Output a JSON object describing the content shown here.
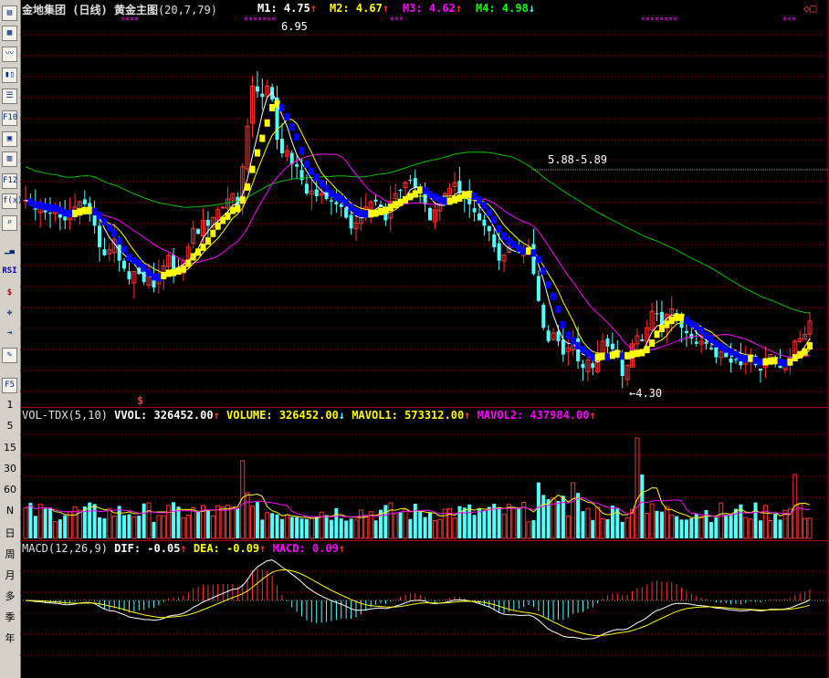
{
  "toolbar": {
    "icons": [
      "menu-icon",
      "grid-icon",
      "line-chart-icon",
      "candle-icon",
      "list-icon",
      "f10-icon",
      "book-icon",
      "doc-icon",
      "f12-icon",
      "fx-icon",
      "search-icon",
      "bar-chart-icon",
      "rsi-icon",
      "dollar-icon",
      "move-icon",
      "export-icon",
      "pen-icon",
      "f5-icon"
    ],
    "labels": {
      "f10": "F10",
      "f12": "F12",
      "fx": "f(x)",
      "rsi": "RSI",
      "f5": "F5"
    },
    "periods": [
      "1",
      "5",
      "15",
      "30",
      "60",
      "N",
      "日",
      "周",
      "月",
      "多",
      "季",
      "年"
    ]
  },
  "main": {
    "stock_name": "金地集团",
    "period_label": "(日线)",
    "indicator_name": "黄金主图",
    "params": "(20,7,79)",
    "m1": {
      "label": "M1:",
      "value": "4.75",
      "color": "#ffffff"
    },
    "m2": {
      "label": "M2:",
      "value": "4.67",
      "color": "#ffff00"
    },
    "m3": {
      "label": "M3:",
      "value": "4.62",
      "color": "#ff00ff"
    },
    "m4": {
      "label": "M4:",
      "value": "4.98",
      "color": "#00ff00"
    },
    "high_label": "6.95",
    "low_label": "←4.30",
    "range_label": "5.88-5.89",
    "marker": "$",
    "corner_icon": "diamond-icon",
    "price_range": [
      4.15,
      7.02
    ]
  },
  "volume": {
    "name": "VOL-TDX(5,10)",
    "vvol": {
      "label": "VVOL:",
      "value": "326452.00"
    },
    "volume": {
      "label": "VOLUME:",
      "value": "326452.00"
    },
    "mavol1": {
      "label": "MAVOL1:",
      "value": "573312.00"
    },
    "mavol2": {
      "label": "MAVOL2:",
      "value": "437984.00"
    }
  },
  "macd": {
    "name": "MACD(12,26,9)",
    "dif": {
      "label": "DIF:",
      "value": "-0.05"
    },
    "dea": {
      "label": "DEA:",
      "value": "-0.09"
    },
    "macd": {
      "label": "MACD:",
      "value": "0.09"
    }
  },
  "colors": {
    "up": "#ff3232",
    "down": "#54ffff",
    "ma_white": "#ffffff",
    "ma_yellow": "#ffff00",
    "ma_magenta": "#ff00ff",
    "ma_green": "#00c000",
    "step_yellow": "#ffff00",
    "step_blue": "#0000ff",
    "grid": "#8b0000"
  },
  "chart_data": {
    "type": "candlestick",
    "closes": [
      5.65,
      5.62,
      5.58,
      5.6,
      5.56,
      5.55,
      5.58,
      5.52,
      5.5,
      5.55,
      5.6,
      5.64,
      5.62,
      5.58,
      5.46,
      5.3,
      5.24,
      5.28,
      5.36,
      5.2,
      5.14,
      5.06,
      5.12,
      5.1,
      5.04,
      5.1,
      5.0,
      5.1,
      5.16,
      5.24,
      5.14,
      5.12,
      5.2,
      5.3,
      5.44,
      5.4,
      5.5,
      5.46,
      5.52,
      5.58,
      5.6,
      5.66,
      5.7,
      5.6,
      5.9,
      6.2,
      6.5,
      6.46,
      6.42,
      6.5,
      6.4,
      6.1,
      6.0,
      6.02,
      5.92,
      5.9,
      5.8,
      5.7,
      5.72,
      5.68,
      5.7,
      5.66,
      5.64,
      5.62,
      5.6,
      5.52,
      5.44,
      5.48,
      5.56,
      5.6,
      5.64,
      5.64,
      5.6,
      5.5,
      5.64,
      5.7,
      5.72,
      5.78,
      5.8,
      5.74,
      5.7,
      5.62,
      5.5,
      5.58,
      5.66,
      5.7,
      5.74,
      5.78,
      5.7,
      5.66,
      5.62,
      5.56,
      5.5,
      5.46,
      5.42,
      5.3,
      5.2,
      5.24,
      5.3,
      5.32,
      5.26,
      5.28,
      5.3,
      5.1,
      4.9,
      4.7,
      4.6,
      4.66,
      4.6,
      4.5,
      4.55,
      4.6,
      4.45,
      4.4,
      4.46,
      4.4,
      4.5,
      4.6,
      4.56,
      4.54,
      4.48,
      4.34,
      4.42,
      4.58,
      4.64,
      4.6,
      4.7,
      4.82,
      4.8,
      4.72,
      4.8,
      4.84,
      4.76,
      4.7,
      4.66,
      4.62,
      4.58,
      4.6,
      4.58,
      4.54,
      4.48,
      4.52,
      4.48,
      4.44,
      4.46,
      4.42,
      4.48,
      4.5,
      4.42,
      4.38,
      4.46,
      4.5,
      4.44,
      4.4,
      4.45,
      4.48,
      4.6,
      4.62,
      4.65,
      4.75
    ]
  }
}
